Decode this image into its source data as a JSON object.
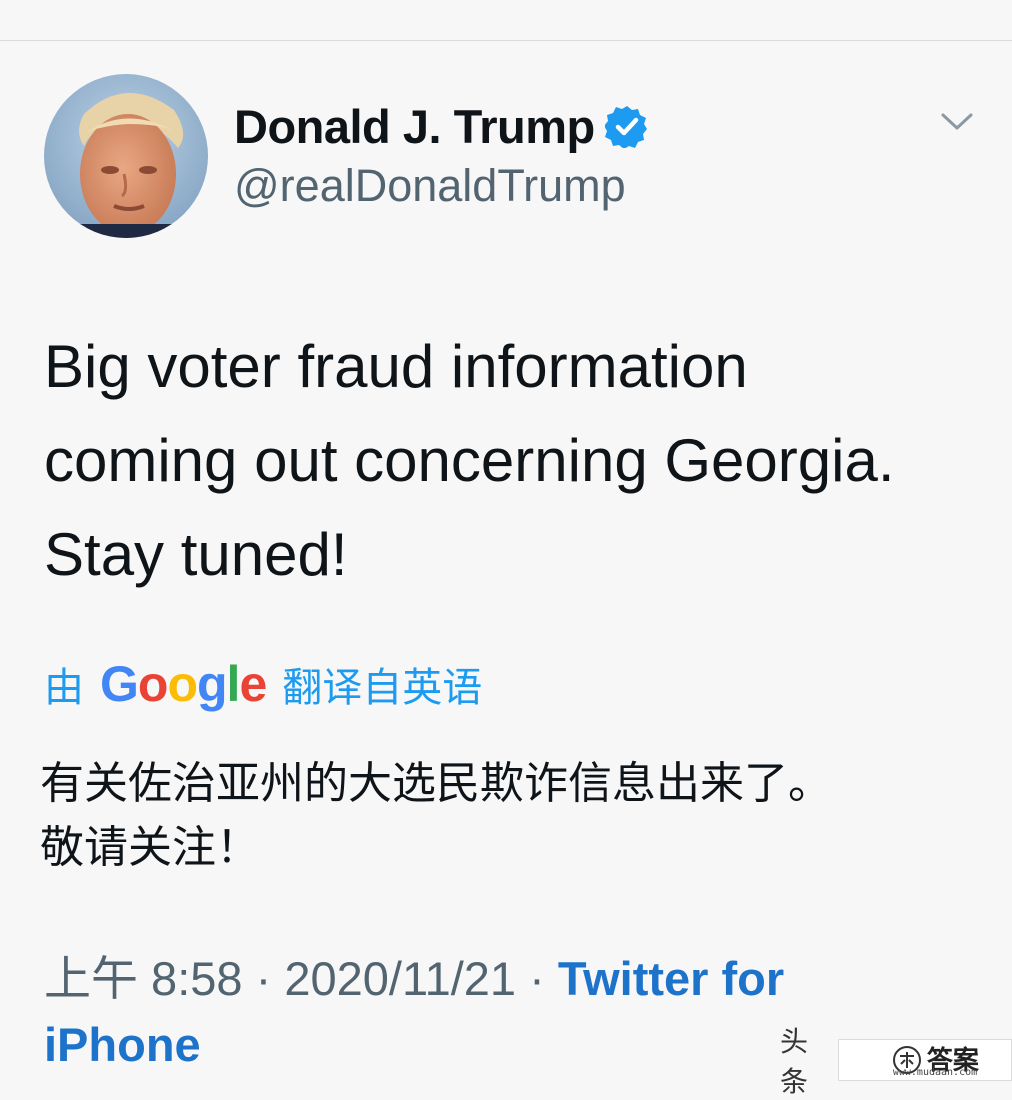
{
  "author": {
    "name": "Donald J. Trump",
    "handle": "@realDonaldTrump",
    "verified": true,
    "avatar_icon": "profile-photo"
  },
  "tweet": {
    "lines": [
      "Big voter fraud information",
      "coming out concerning Georgia.",
      "Stay tuned!"
    ]
  },
  "translation": {
    "prefix": "由",
    "provider": "Google",
    "suffix": "翻译自英语",
    "lines": [
      "有关佐治亚州的大选民欺诈信息出来了。",
      "敬请关注！"
    ]
  },
  "meta": {
    "time": "上午 8:58",
    "sep1": " · ",
    "date": "2020/11/21",
    "sep2": " · ",
    "source_line1": "Twitter for",
    "source_line2": "iPhone"
  },
  "watermark": {
    "left_text": "头条",
    "brand": "答案",
    "url": "www.mudaan.com"
  },
  "colors": {
    "accent": "#1d9bf0",
    "source_link": "#1d73c9",
    "muted": "#536471",
    "background": "#f7f7f8"
  }
}
